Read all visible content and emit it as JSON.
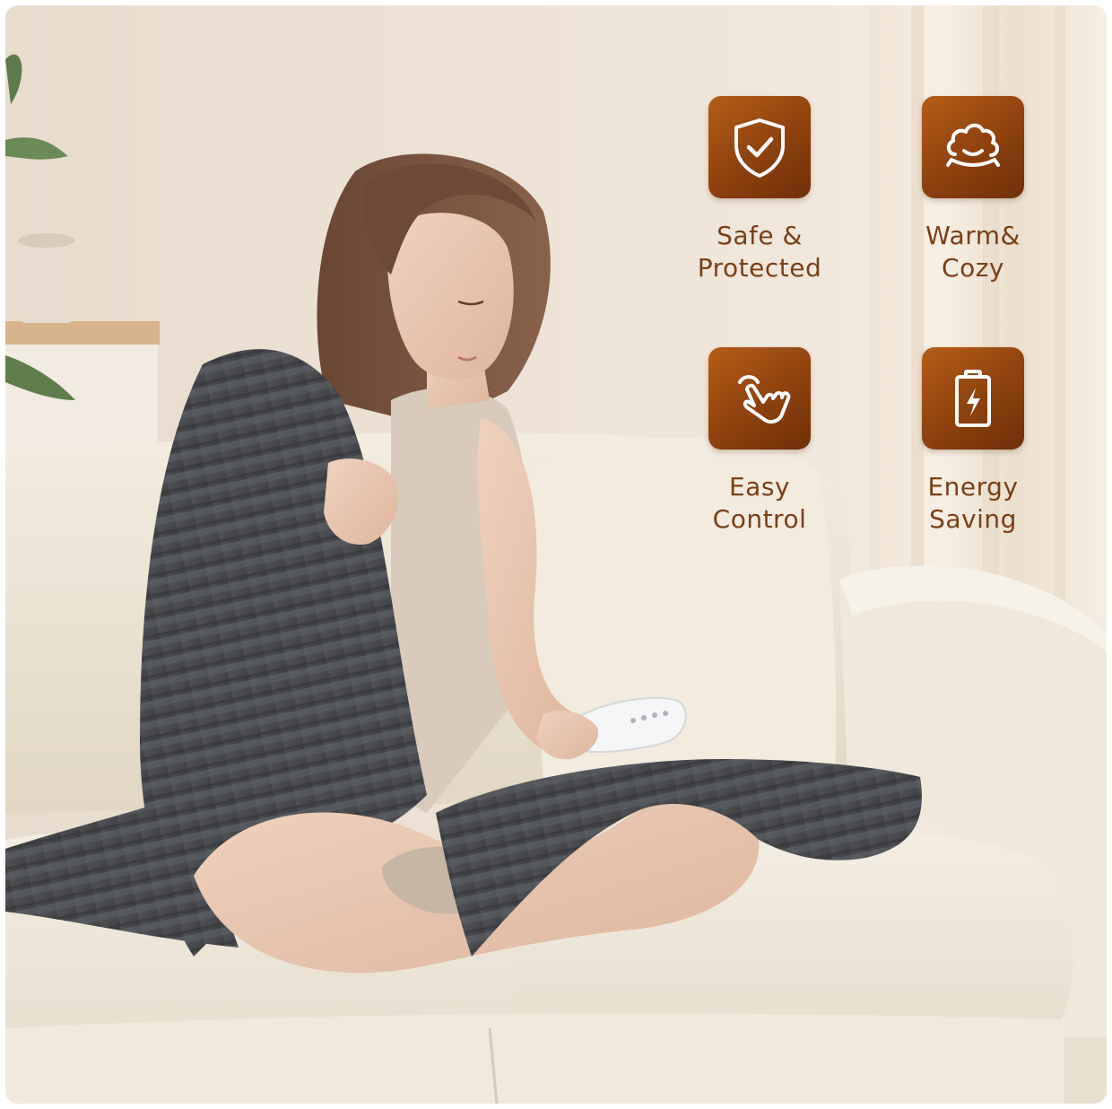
{
  "features": [
    {
      "line1": "Safe &",
      "line2": "Protected",
      "icon": "shield-check-icon"
    },
    {
      "line1": "Warm&",
      "line2": "Cozy",
      "icon": "cloud-smile-icon"
    },
    {
      "line1": "Easy",
      "line2": "Control",
      "icon": "hand-tap-icon"
    },
    {
      "line1": "Energy",
      "line2": "Saving",
      "icon": "battery-bolt-icon"
    }
  ],
  "colors": {
    "accent": "#9a4a10",
    "label_text": "#7a3f15",
    "wall": "#eee3d7",
    "sofa": "#efe7d8",
    "blanket": "#4a4c50"
  }
}
